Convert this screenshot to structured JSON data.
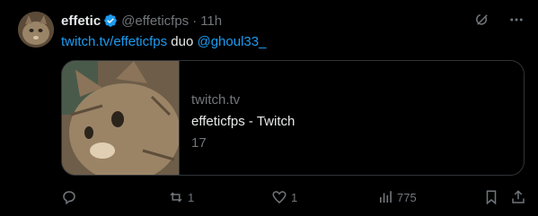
{
  "tweet": {
    "author_name": "effetic",
    "handle": "@effeticfps",
    "separator": "·",
    "time": "11h",
    "text_link": "twitch.tv/effeticfps",
    "text_middle": " duo ",
    "mention": "@ghoul33_"
  },
  "card": {
    "domain": "twitch.tv",
    "title": "effeticfps - Twitch",
    "description": "17"
  },
  "actions": {
    "reply_count": "",
    "retweet_count": "1",
    "like_count": "1",
    "views_count": "775"
  },
  "colors": {
    "background": "#000000",
    "text": "#e7e9ea",
    "muted": "#71767b",
    "accent": "#1d9bf0",
    "border": "#2f3336"
  },
  "icons": {
    "verified": "verified-badge-icon",
    "grok": "grok-icon",
    "more": "more-icon",
    "reply": "reply-icon",
    "retweet": "retweet-icon",
    "like": "like-icon",
    "views": "views-icon",
    "bookmark": "bookmark-icon",
    "share": "share-icon"
  }
}
